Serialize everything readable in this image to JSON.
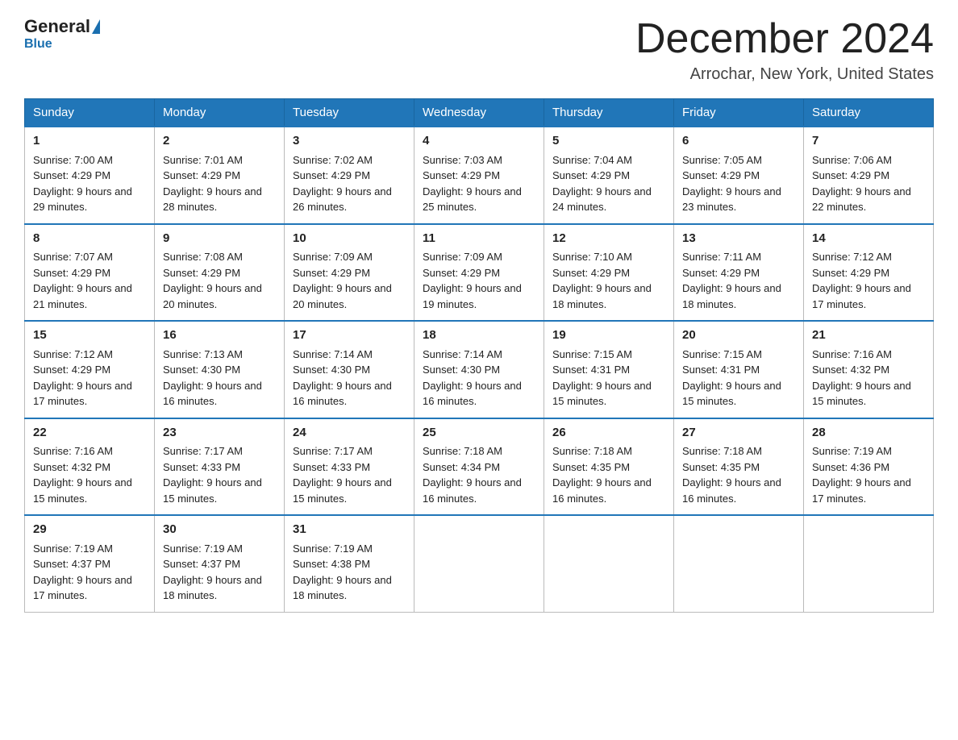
{
  "header": {
    "logo_general": "General",
    "logo_blue": "Blue",
    "month_title": "December 2024",
    "location": "Arrochar, New York, United States"
  },
  "days_of_week": [
    "Sunday",
    "Monday",
    "Tuesday",
    "Wednesday",
    "Thursday",
    "Friday",
    "Saturday"
  ],
  "weeks": [
    [
      {
        "day": "1",
        "sunrise": "7:00 AM",
        "sunset": "4:29 PM",
        "daylight": "9 hours and 29 minutes."
      },
      {
        "day": "2",
        "sunrise": "7:01 AM",
        "sunset": "4:29 PM",
        "daylight": "9 hours and 28 minutes."
      },
      {
        "day": "3",
        "sunrise": "7:02 AM",
        "sunset": "4:29 PM",
        "daylight": "9 hours and 26 minutes."
      },
      {
        "day": "4",
        "sunrise": "7:03 AM",
        "sunset": "4:29 PM",
        "daylight": "9 hours and 25 minutes."
      },
      {
        "day": "5",
        "sunrise": "7:04 AM",
        "sunset": "4:29 PM",
        "daylight": "9 hours and 24 minutes."
      },
      {
        "day": "6",
        "sunrise": "7:05 AM",
        "sunset": "4:29 PM",
        "daylight": "9 hours and 23 minutes."
      },
      {
        "day": "7",
        "sunrise": "7:06 AM",
        "sunset": "4:29 PM",
        "daylight": "9 hours and 22 minutes."
      }
    ],
    [
      {
        "day": "8",
        "sunrise": "7:07 AM",
        "sunset": "4:29 PM",
        "daylight": "9 hours and 21 minutes."
      },
      {
        "day": "9",
        "sunrise": "7:08 AM",
        "sunset": "4:29 PM",
        "daylight": "9 hours and 20 minutes."
      },
      {
        "day": "10",
        "sunrise": "7:09 AM",
        "sunset": "4:29 PM",
        "daylight": "9 hours and 20 minutes."
      },
      {
        "day": "11",
        "sunrise": "7:09 AM",
        "sunset": "4:29 PM",
        "daylight": "9 hours and 19 minutes."
      },
      {
        "day": "12",
        "sunrise": "7:10 AM",
        "sunset": "4:29 PM",
        "daylight": "9 hours and 18 minutes."
      },
      {
        "day": "13",
        "sunrise": "7:11 AM",
        "sunset": "4:29 PM",
        "daylight": "9 hours and 18 minutes."
      },
      {
        "day": "14",
        "sunrise": "7:12 AM",
        "sunset": "4:29 PM",
        "daylight": "9 hours and 17 minutes."
      }
    ],
    [
      {
        "day": "15",
        "sunrise": "7:12 AM",
        "sunset": "4:29 PM",
        "daylight": "9 hours and 17 minutes."
      },
      {
        "day": "16",
        "sunrise": "7:13 AM",
        "sunset": "4:30 PM",
        "daylight": "9 hours and 16 minutes."
      },
      {
        "day": "17",
        "sunrise": "7:14 AM",
        "sunset": "4:30 PM",
        "daylight": "9 hours and 16 minutes."
      },
      {
        "day": "18",
        "sunrise": "7:14 AM",
        "sunset": "4:30 PM",
        "daylight": "9 hours and 16 minutes."
      },
      {
        "day": "19",
        "sunrise": "7:15 AM",
        "sunset": "4:31 PM",
        "daylight": "9 hours and 15 minutes."
      },
      {
        "day": "20",
        "sunrise": "7:15 AM",
        "sunset": "4:31 PM",
        "daylight": "9 hours and 15 minutes."
      },
      {
        "day": "21",
        "sunrise": "7:16 AM",
        "sunset": "4:32 PM",
        "daylight": "9 hours and 15 minutes."
      }
    ],
    [
      {
        "day": "22",
        "sunrise": "7:16 AM",
        "sunset": "4:32 PM",
        "daylight": "9 hours and 15 minutes."
      },
      {
        "day": "23",
        "sunrise": "7:17 AM",
        "sunset": "4:33 PM",
        "daylight": "9 hours and 15 minutes."
      },
      {
        "day": "24",
        "sunrise": "7:17 AM",
        "sunset": "4:33 PM",
        "daylight": "9 hours and 15 minutes."
      },
      {
        "day": "25",
        "sunrise": "7:18 AM",
        "sunset": "4:34 PM",
        "daylight": "9 hours and 16 minutes."
      },
      {
        "day": "26",
        "sunrise": "7:18 AM",
        "sunset": "4:35 PM",
        "daylight": "9 hours and 16 minutes."
      },
      {
        "day": "27",
        "sunrise": "7:18 AM",
        "sunset": "4:35 PM",
        "daylight": "9 hours and 16 minutes."
      },
      {
        "day": "28",
        "sunrise": "7:19 AM",
        "sunset": "4:36 PM",
        "daylight": "9 hours and 17 minutes."
      }
    ],
    [
      {
        "day": "29",
        "sunrise": "7:19 AM",
        "sunset": "4:37 PM",
        "daylight": "9 hours and 17 minutes."
      },
      {
        "day": "30",
        "sunrise": "7:19 AM",
        "sunset": "4:37 PM",
        "daylight": "9 hours and 18 minutes."
      },
      {
        "day": "31",
        "sunrise": "7:19 AM",
        "sunset": "4:38 PM",
        "daylight": "9 hours and 18 minutes."
      },
      null,
      null,
      null,
      null
    ]
  ]
}
